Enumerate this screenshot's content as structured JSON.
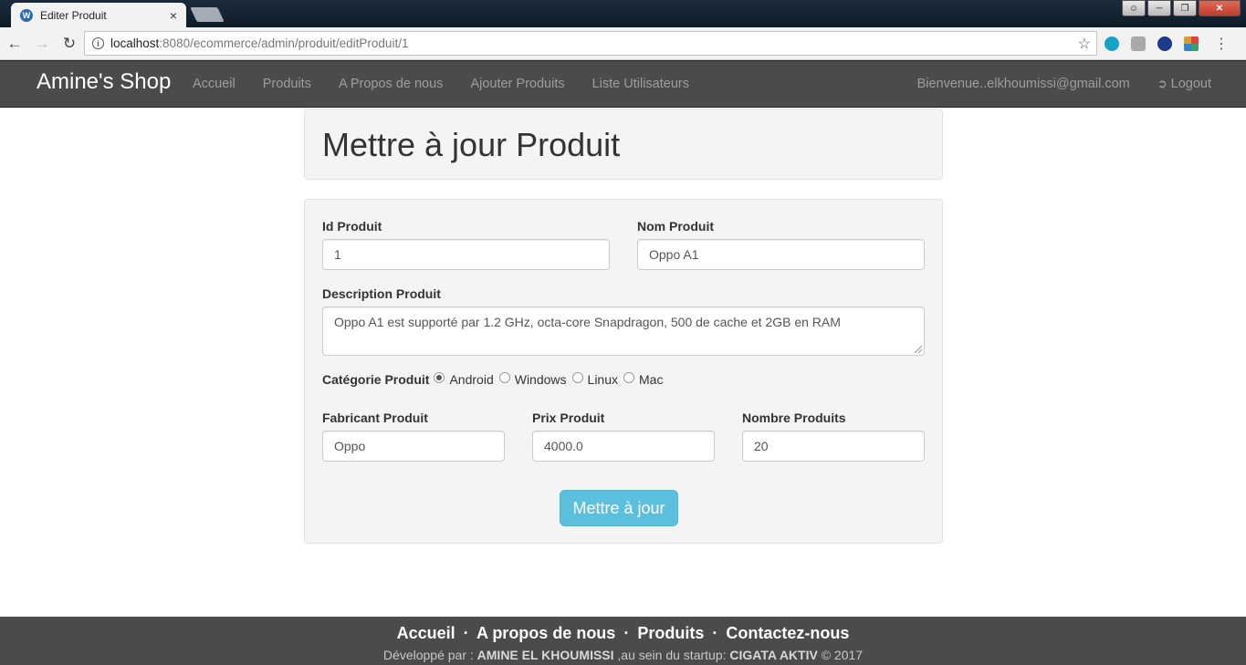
{
  "browser": {
    "tab_title": "Editer Produit",
    "tab_close": "×",
    "url_host": "localhost",
    "url_path": ":8080/ecommerce/admin/produit/editProduit/1"
  },
  "navbar": {
    "brand": "Amine's Shop",
    "links": [
      "Accueil",
      "Produits",
      "A Propos de nous",
      "Ajouter Produits",
      "Liste Utilisateurs"
    ],
    "welcome": "Bienvenue..elkhoumissi@gmail.com",
    "logout": "Logout"
  },
  "header": {
    "title": "Mettre à jour Produit"
  },
  "form": {
    "id_label": "Id Produit",
    "id_value": "1",
    "nom_label": "Nom Produit",
    "nom_value": "Oppo A1",
    "desc_label": "Description Produit",
    "desc_value": "Oppo A1 est supporté par 1.2 GHz, octa-core Snapdragon, 500 de cache et 2GB en RAM",
    "cat_label": "Catégorie Produit",
    "categories": [
      {
        "label": "Android",
        "checked": true
      },
      {
        "label": "Windows",
        "checked": false
      },
      {
        "label": "Linux",
        "checked": false
      },
      {
        "label": "Mac",
        "checked": false
      }
    ],
    "fabricant_label": "Fabricant Produit",
    "fabricant_value": "Oppo",
    "prix_label": "Prix Produit",
    "prix_value": "4000.0",
    "nombre_label": "Nombre Produits",
    "nombre_value": "20",
    "submit": "Mettre à jour"
  },
  "footer": {
    "links": [
      "Accueil",
      "A propos de nous",
      "Produits",
      "Contactez-nous"
    ],
    "separator": "·",
    "credit_prefix": "Développé par : ",
    "credit_author": "AMINE EL KHOUMISSI",
    "credit_middle": " ,au sein du startup: ",
    "credit_company": "CIGATA AKTIV",
    "credit_suffix": " © 2017"
  },
  "colors": {
    "navbar_bg": "#4b4b4b",
    "button_info": "#5bc0de",
    "well_bg": "#f4f4f4"
  }
}
